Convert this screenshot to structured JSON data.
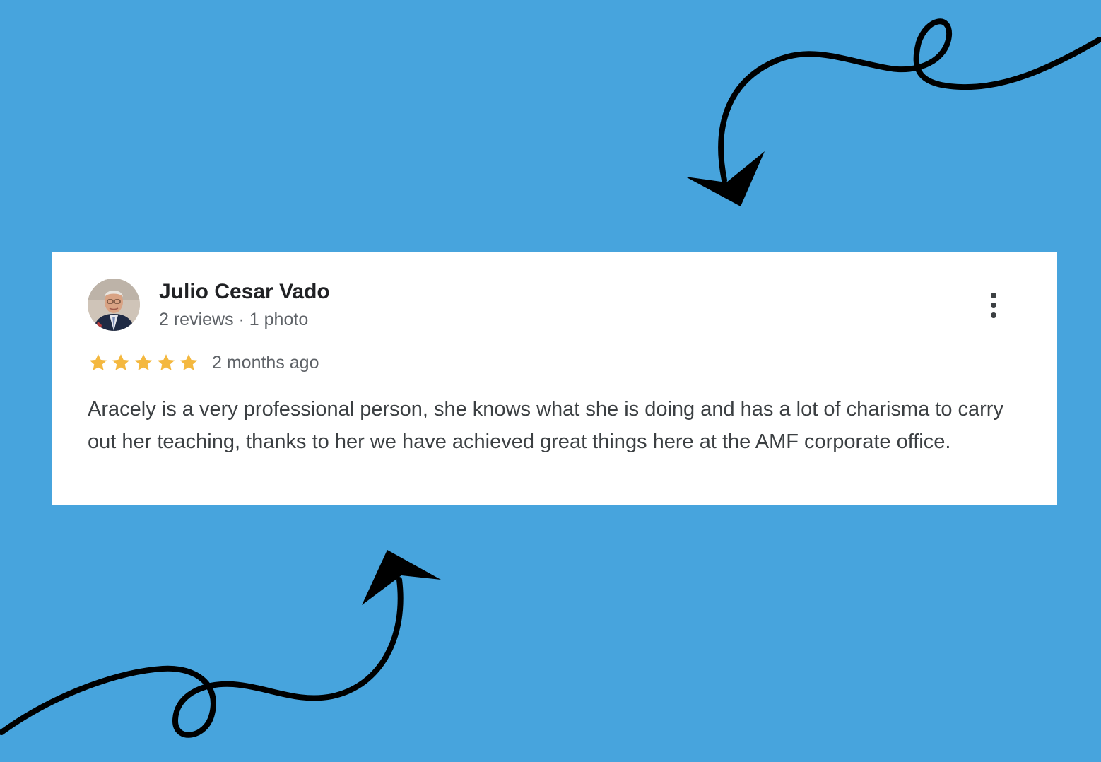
{
  "colors": {
    "background": "#47a4dd",
    "card": "#ffffff",
    "star": "#f4b83f",
    "arrow": "#000000",
    "dots": "#3c4043"
  },
  "review": {
    "reviewer_name": "Julio Cesar Vado",
    "reviewer_meta": "2 reviews · 1 photo",
    "rating": 5,
    "rating_max": 5,
    "date": "2 months ago",
    "text": "Aracely is a very professional person, she knows what she is doing and has a lot of charisma to carry out her teaching, thanks to her we have achieved great things here at the AMF corporate office."
  },
  "icons": {
    "more": "more-vert-icon",
    "star": "star-icon",
    "avatar": "reviewer-avatar-photo",
    "arrows": "hand-drawn-arrow-icon"
  }
}
